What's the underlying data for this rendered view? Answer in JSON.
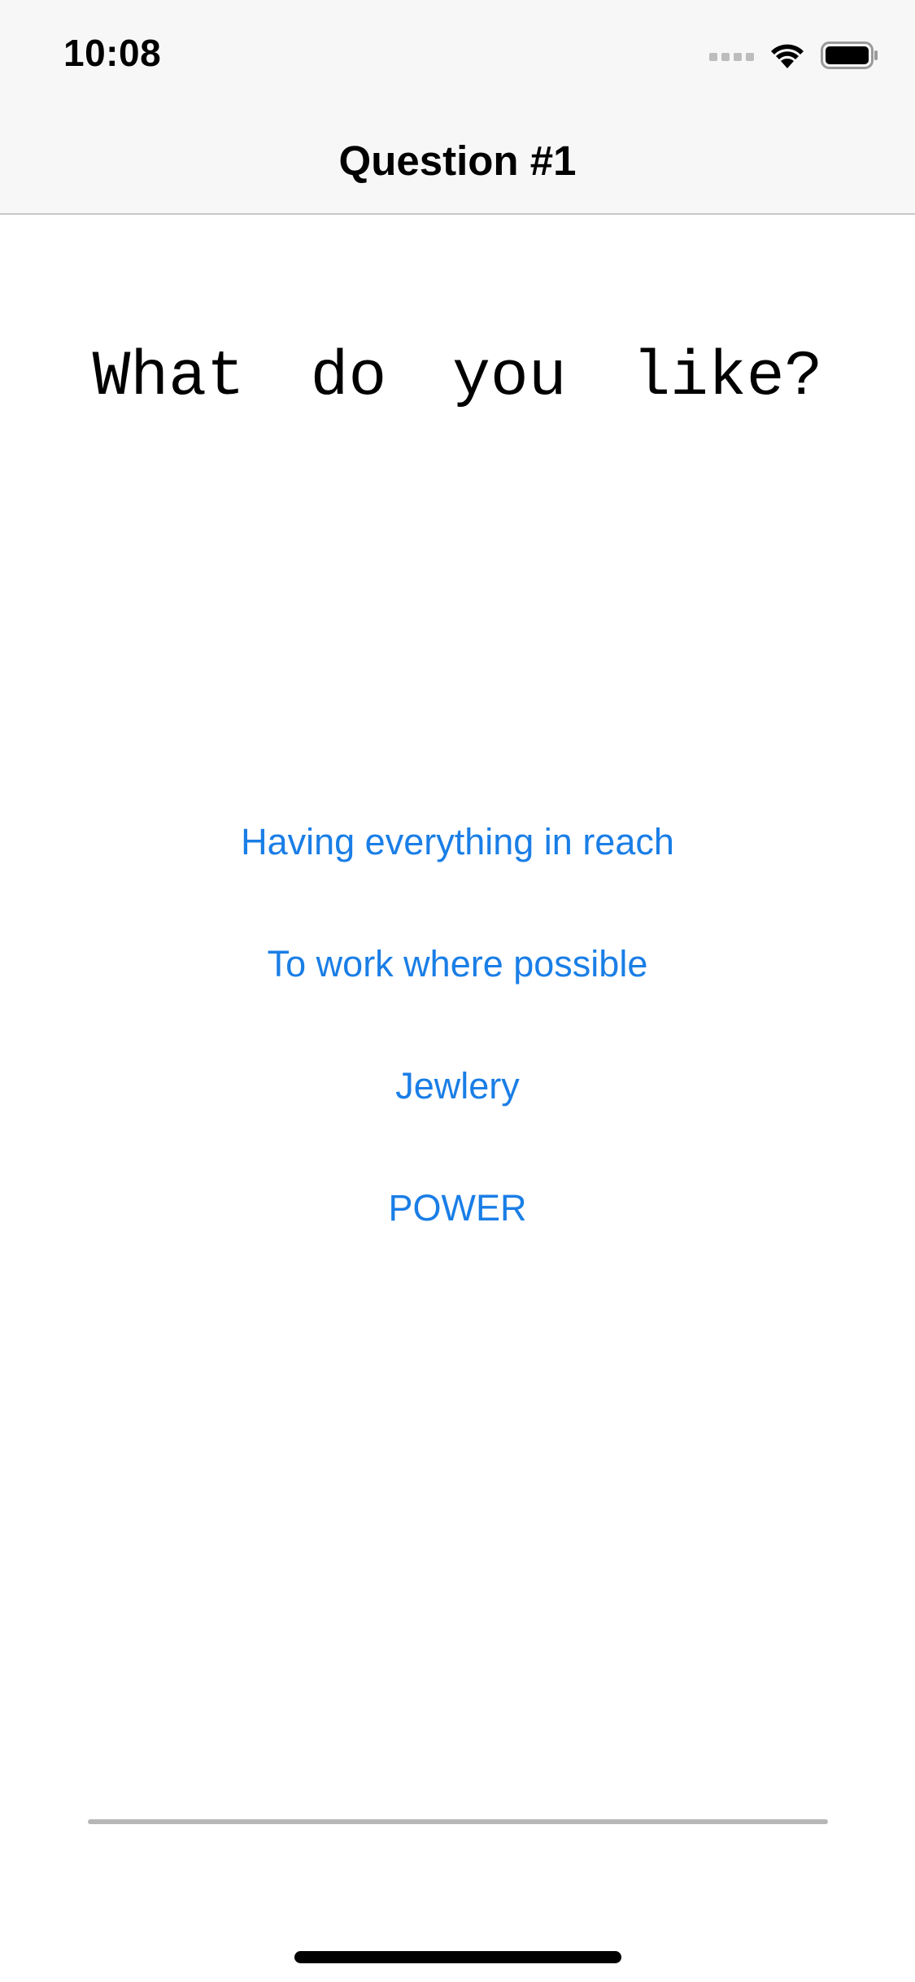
{
  "status_bar": {
    "time": "10:08",
    "icons": [
      "signal-icon",
      "wifi-icon",
      "battery-icon"
    ]
  },
  "nav_bar": {
    "title": "Question #1"
  },
  "question": {
    "text": "What do you like?"
  },
  "answers": [
    {
      "label": "Having everything in reach"
    },
    {
      "label": "To work where possible"
    },
    {
      "label": "Jewlery"
    },
    {
      "label": "POWER"
    }
  ],
  "progress": {
    "fraction": 0.0
  },
  "colors": {
    "accent": "#1a7ee6",
    "nav_background": "#f7f7f7",
    "progress_track": "#b7b7b7"
  }
}
